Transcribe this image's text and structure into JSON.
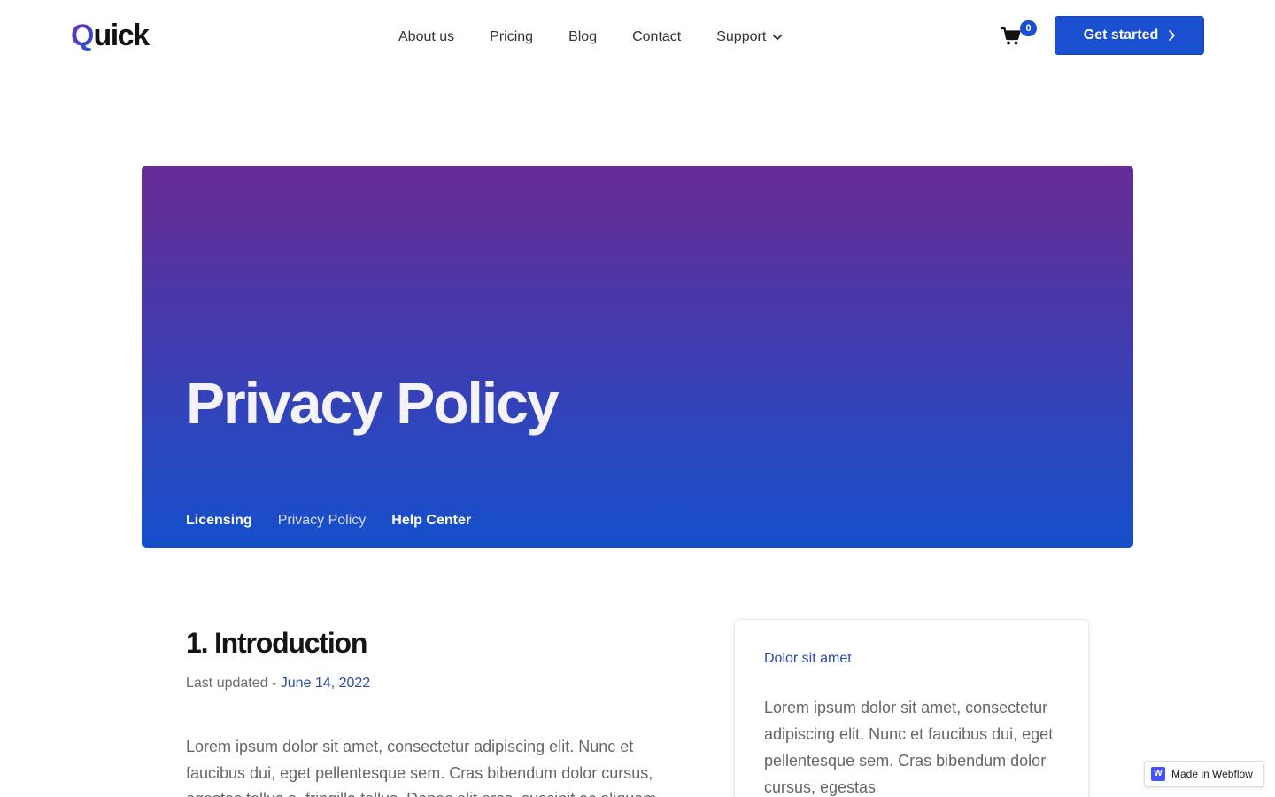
{
  "header": {
    "logo_initial": "Q",
    "logo_rest": "uick",
    "nav": {
      "about": "About us",
      "pricing": "Pricing",
      "blog": "Blog",
      "contact": "Contact",
      "support": "Support"
    },
    "cart_count": "0",
    "cta_label": "Get started"
  },
  "hero": {
    "title": "Privacy Policy",
    "links": {
      "licensing": "Licensing",
      "privacy": "Privacy Policy",
      "help": "Help Center"
    }
  },
  "content": {
    "section_title": "1. Introduction",
    "updated_label": "Last updated - ",
    "updated_date": "June 14, 2022",
    "body": "Lorem ipsum dolor sit amet, consectetur adipiscing elit. Nunc et faucibus dui, eget pellentesque sem. Cras bibendum dolor cursus, egestas tellus a, fringilla tellus. Donec elit eros, suscipit ac aliquam"
  },
  "sidebar_card": {
    "title": "Dolor sit amet",
    "text": "Lorem ipsum dolor sit amet, consectetur adipiscing elit. Nunc et faucibus dui, eget pellentesque sem. Cras bibendum dolor cursus, egestas"
  },
  "badge": {
    "icon_letter": "W",
    "label": "Made in Webflow"
  },
  "colors": {
    "primary": "#1a4fd0",
    "hero_top": "#682b94",
    "hero_bottom": "#154fcb",
    "link": "#2b4aa8"
  }
}
